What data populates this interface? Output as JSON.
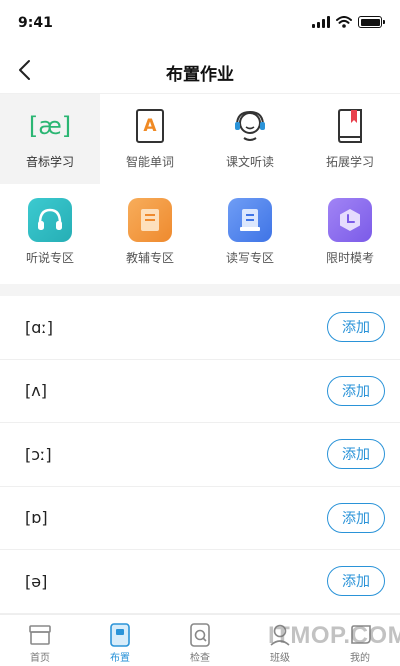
{
  "status_bar": {
    "time": "9:41"
  },
  "header": {
    "title": "布置作业"
  },
  "grid": {
    "items": [
      {
        "label": "音标学习",
        "icon": "phonetic-icon",
        "glyph": "[æ]",
        "active": true
      },
      {
        "label": "智能单词",
        "icon": "word-card-icon",
        "glyph": "A"
      },
      {
        "label": "课文听读",
        "icon": "headset-person-icon"
      },
      {
        "label": "拓展学习",
        "icon": "bookmark-book-icon"
      },
      {
        "label": "听说专区",
        "icon": "headphones-icon",
        "color": "#2dbdc2"
      },
      {
        "label": "教辅专区",
        "icon": "book-icon",
        "color": "#f29a3f"
      },
      {
        "label": "读写专区",
        "icon": "notebook-icon",
        "color": "#4f86f0"
      },
      {
        "label": "限时模考",
        "icon": "clock-icon",
        "color": "#8c6cf0"
      }
    ]
  },
  "phonetics": {
    "add_label": "添加",
    "items": [
      "[ɑː]",
      "[ʌ]",
      "[ɔː]",
      "[ɒ]",
      "[ə]"
    ]
  },
  "tabs": [
    {
      "label": "首页",
      "icon": "home-icon"
    },
    {
      "label": "布置",
      "icon": "assign-icon",
      "active": true
    },
    {
      "label": "检查",
      "icon": "check-icon"
    },
    {
      "label": "班级",
      "icon": "class-icon"
    },
    {
      "label": "我的",
      "icon": "profile-icon"
    }
  ],
  "watermark": "ITMOP.COM",
  "colors": {
    "accent": "#2a93d8",
    "phonetic_green": "#2bb673",
    "word_orange": "#f08a24"
  }
}
